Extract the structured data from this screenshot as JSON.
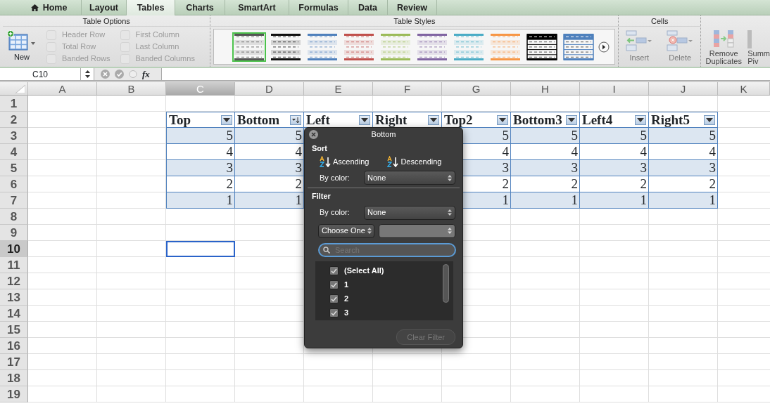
{
  "tabs": [
    {
      "label": "Home",
      "selected": false
    },
    {
      "label": "Layout",
      "selected": false
    },
    {
      "label": "Tables",
      "selected": true
    },
    {
      "label": "Charts",
      "selected": false
    },
    {
      "label": "SmartArt",
      "selected": false
    },
    {
      "label": "Formulas",
      "selected": false
    },
    {
      "label": "Data",
      "selected": false
    },
    {
      "label": "Review",
      "selected": false
    }
  ],
  "ribbon": {
    "table_options": {
      "title": "Table Options",
      "new_label": "New",
      "disabled": true,
      "checkboxes": [
        {
          "label": "Header Row",
          "checked": false
        },
        {
          "label": "Total Row",
          "checked": false
        },
        {
          "label": "Banded Rows",
          "checked": false
        },
        {
          "label": "First Column",
          "checked": false
        },
        {
          "label": "Last Column",
          "checked": false
        },
        {
          "label": "Banded Columns",
          "checked": false
        }
      ]
    },
    "table_styles": {
      "title": "Table Styles",
      "styles": [
        {
          "kind": "light",
          "color": "#555555",
          "selected": true
        },
        {
          "kind": "light",
          "color": "#111111",
          "selected": false
        },
        {
          "kind": "light",
          "color": "#4f81bd",
          "selected": false
        },
        {
          "kind": "light",
          "color": "#c0504d",
          "selected": false
        },
        {
          "kind": "light",
          "color": "#9bbb59",
          "selected": false
        },
        {
          "kind": "light",
          "color": "#8064a2",
          "selected": false
        },
        {
          "kind": "light",
          "color": "#4bacc6",
          "selected": false
        },
        {
          "kind": "light",
          "color": "#f79646",
          "selected": false
        },
        {
          "kind": "dark",
          "color": "#000000",
          "selected": false
        },
        {
          "kind": "dark",
          "color": "#4f81bd",
          "selected": false
        }
      ]
    },
    "cells": {
      "title": "Cells",
      "disabled": true,
      "buttons": [
        {
          "label": "Insert",
          "kind": "insert"
        },
        {
          "label": "Delete",
          "kind": "delete"
        }
      ]
    },
    "tools": {
      "remove_duplicates": "Remove Duplicates",
      "cut_button_lines": [
        "Summ",
        "Piv"
      ]
    }
  },
  "formula_bar": {
    "name_box": "C10",
    "fx_label": "fx"
  },
  "sheet": {
    "columns": [
      {
        "label": "A",
        "selected": false
      },
      {
        "label": "B",
        "selected": false
      },
      {
        "label": "C",
        "selected": true
      },
      {
        "label": "D",
        "selected": false
      },
      {
        "label": "E",
        "selected": false
      },
      {
        "label": "F",
        "selected": false
      },
      {
        "label": "G",
        "selected": false
      },
      {
        "label": "H",
        "selected": false
      },
      {
        "label": "I",
        "selected": false
      },
      {
        "label": "J",
        "selected": false
      },
      {
        "label": "K",
        "selected": false
      }
    ],
    "rows": [
      {
        "label": "1",
        "selected": false
      },
      {
        "label": "2",
        "selected": false
      },
      {
        "label": "3",
        "selected": false
      },
      {
        "label": "4",
        "selected": false
      },
      {
        "label": "5",
        "selected": false
      },
      {
        "label": "6",
        "selected": false
      },
      {
        "label": "7",
        "selected": false
      },
      {
        "label": "8",
        "selected": false
      },
      {
        "label": "9",
        "selected": false
      },
      {
        "label": "10",
        "selected": true
      },
      {
        "label": "11",
        "selected": false
      },
      {
        "label": "12",
        "selected": false
      },
      {
        "label": "13",
        "selected": false
      },
      {
        "label": "14",
        "selected": false
      },
      {
        "label": "15",
        "selected": false
      },
      {
        "label": "16",
        "selected": false
      },
      {
        "label": "17",
        "selected": false
      },
      {
        "label": "18",
        "selected": false
      },
      {
        "label": "19",
        "selected": false
      }
    ],
    "table": {
      "headers": [
        {
          "label": "Top",
          "kind": "filter"
        },
        {
          "label": "Bottom",
          "kind": "sorted"
        },
        {
          "label": "Left",
          "kind": "filter"
        },
        {
          "label": "Right",
          "kind": "filter"
        },
        {
          "label": "Top2",
          "kind": "filter"
        },
        {
          "label": "Bottom3",
          "kind": "filter"
        },
        {
          "label": "Left4",
          "kind": "filter"
        },
        {
          "label": "Right5",
          "kind": "filter"
        }
      ],
      "rows": [
        [
          "5",
          "5",
          null,
          null,
          "5",
          "5",
          "5",
          "5"
        ],
        [
          "4",
          "4",
          null,
          null,
          "4",
          "4",
          "4",
          "4"
        ],
        [
          "3",
          "3",
          null,
          null,
          "3",
          "3",
          "3",
          "3"
        ],
        [
          "2",
          "2",
          null,
          null,
          "2",
          "2",
          "2",
          "2"
        ],
        [
          "1",
          "1",
          null,
          null,
          "1",
          "1",
          "1",
          "1"
        ]
      ]
    }
  },
  "filter_popup": {
    "title": "Bottom",
    "sort_label": "Sort",
    "ascending": "Ascending",
    "descending": "Descending",
    "sort_by_color_label": "By color:",
    "sort_by_color_value": "None",
    "filter_label": "Filter",
    "filter_by_color_label": "By color:",
    "filter_by_color_value": "None",
    "condition_select": "Choose One",
    "search_placeholder": "Search",
    "items": [
      {
        "label": "(Select All)",
        "checked": true
      },
      {
        "label": "1",
        "checked": true
      },
      {
        "label": "2",
        "checked": true
      },
      {
        "label": "3",
        "checked": true
      }
    ],
    "clear_filter": {
      "label": "Clear Filter",
      "disabled": true
    }
  }
}
